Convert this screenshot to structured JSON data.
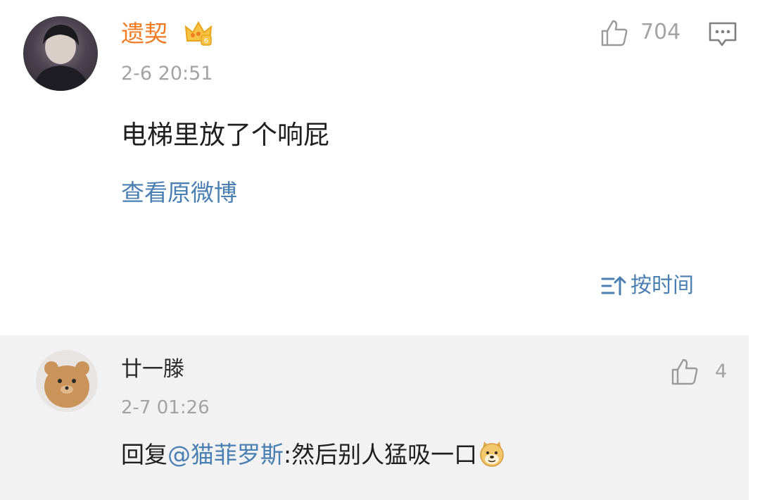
{
  "main_comment": {
    "username": "遗契",
    "badge_icon": "vip-crown-icon",
    "time": "2-6 20:51",
    "content": "电梯里放了个响屁",
    "view_original": "查看原微博",
    "likes": "704"
  },
  "sort": {
    "label": "按时间",
    "icon": "sort-icon"
  },
  "reply": {
    "username": "廿一滕",
    "time": "2-7 01:26",
    "prefix": "回复",
    "mention": "@猫菲罗斯",
    "text": ":然后别人猛吸一口",
    "emoji": "doge-emoji-icon",
    "likes": "4"
  },
  "colors": {
    "username_orange": "#f07b22",
    "link_blue": "#4a7fb2",
    "meta_gray": "#a3a3a3",
    "reply_bg": "#f2f2f2"
  }
}
